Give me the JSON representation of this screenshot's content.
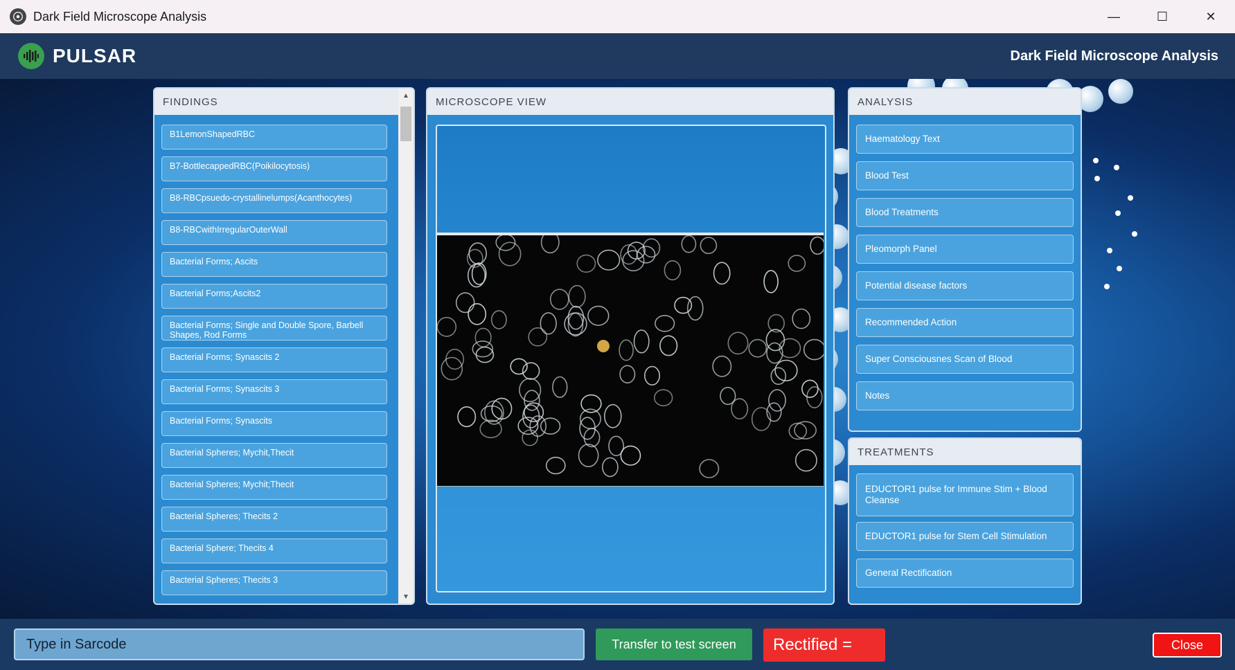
{
  "window": {
    "title": "Dark Field Microscope Analysis",
    "controls": {
      "minimize": "—",
      "maximize": "☐",
      "close": "✕"
    }
  },
  "header": {
    "brand": "PULSAR",
    "title": "Dark Field Microscope Analysis"
  },
  "findings": {
    "heading": "FINDINGS",
    "items": [
      "B1LemonShapedRBC",
      "B7-BottlecappedRBC(Poikilocytosis)",
      "B8-RBCpsuedo-crystallinelumps(Acanthocytes)",
      "B8-RBCwithIrregularOuterWall",
      "Bacterial Forms; Ascits",
      "Bacterial Forms;Ascits2",
      "Bacterial Forms; Single and Double Spore, Barbell Shapes, Rod Forms",
      "Bacterial Forms; Synascits 2",
      "Bacterial Forms; Synascits 3",
      "Bacterial Forms; Synascits",
      "Bacterial Spheres; Mychit,Thecit",
      "Bacterial Spheres; Mychit;Thecit",
      "Bacterial Spheres; Thecits 2",
      "Bacterial Sphere; Thecits 4",
      "Bacterial Spheres; Thecits 3"
    ]
  },
  "microscope": {
    "heading": "MICROSCOPE VIEW"
  },
  "analysis": {
    "heading": "ANALYSIS",
    "items": [
      "Haematology Text",
      "Blood Test",
      "Blood Treatments",
      "Pleomorph Panel",
      "Potential disease factors",
      "Recommended Action",
      "Super Consciousnes Scan of Blood",
      "Notes"
    ]
  },
  "treatments": {
    "heading": "TREATMENTS",
    "items": [
      "EDUCTOR1 pulse for Immune Stim + Blood Cleanse",
      "EDUCTOR1 pulse for Stem Cell Stimulation",
      "General Rectification"
    ]
  },
  "bottom": {
    "sarcode_placeholder": "Type in Sarcode",
    "transfer_label": "Transfer to test screen",
    "rectified_label": "Rectified =",
    "close_label": "Close"
  },
  "colors": {
    "accent_blue": "#4aa3de",
    "transfer_green": "#2f9a5a",
    "alert_red": "#ef2c2c"
  }
}
